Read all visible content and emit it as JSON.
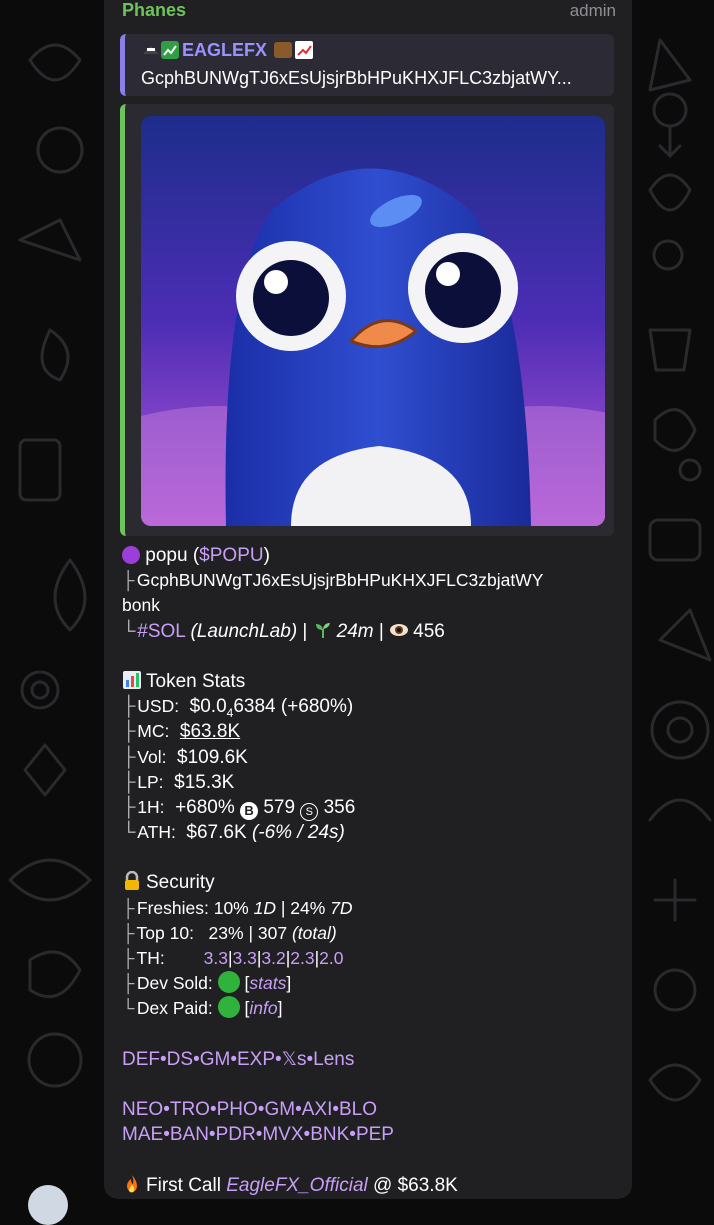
{
  "message": {
    "sender": "Phanes",
    "role": "admin"
  },
  "reply": {
    "title": "EAGLEFX",
    "text": "GcphBUNWgTJ6xEsUjsjrBbHPuKHXJFLC3zbjatWY..."
  },
  "token": {
    "name": "popu",
    "ticker": "($POPU)",
    "address_line1": "GcphBUNWgTJ6xEsUjsjrBbHPuKHXJFLC3zbjatWY",
    "address_line2": "bonk",
    "chain": "#SOL",
    "platform": "(LaunchLab)",
    "age": "24m",
    "views": "456"
  },
  "stats": {
    "heading": "Token Stats",
    "usd_label": "USD:",
    "usd_prefix": "$0.0",
    "usd_sub": "4",
    "usd_suffix": "6384 (+680%)",
    "mc_label": "MC:",
    "mc_value": "$63.8K",
    "vol_label": "Vol:",
    "vol_value": "$109.6K",
    "lp_label": "LP:",
    "lp_value": "$15.3K",
    "h1_label": "1H:",
    "h1_value": "+680%",
    "buys_icon": "B",
    "buys": "579",
    "sells_icon": "S",
    "sells": "356",
    "ath_label": "ATH:",
    "ath_value": "$67.6K",
    "ath_note": "(-6% / 24s)"
  },
  "security": {
    "heading": "Security",
    "freshies_label": "Freshies:",
    "freshies_a": "10%",
    "freshies_a_period": "1D",
    "freshies_b": "24%",
    "freshies_b_period": "7D",
    "top10_label": "Top 10:",
    "top10_pct": "23%",
    "top10_count": "307",
    "top10_note": "(total)",
    "th_label": "TH:",
    "th_values": [
      "3.3",
      "3.3",
      "3.2",
      "2.3",
      "2.0"
    ],
    "devsold_label": "Dev Sold:",
    "devsold_link": "stats",
    "dexpaid_label": "Dex Paid:",
    "dexpaid_link": "info"
  },
  "links_row1": [
    "DEF",
    "DS",
    "GM",
    "EXP",
    "𝕏s",
    "Lens"
  ],
  "links_row2": [
    "NEO",
    "TRO",
    "PHO",
    "GM",
    "AXI",
    "BLO"
  ],
  "links_row3": [
    "MAE",
    "BAN",
    "PDR",
    "MVX",
    "BNK",
    "PEP"
  ],
  "first_call": {
    "label": "First Call",
    "caller": "EagleFX_Official",
    "at": "@ $63.8K"
  },
  "colors": {
    "bubble": "#202023",
    "sender": "#6ec35c",
    "link": "#c89ff7",
    "reply_accent": "#8a7fe6"
  },
  "icons": [
    "chart-bar-icon",
    "lock-icon",
    "fire-icon",
    "seedling-icon",
    "eye-icon",
    "purple-circle-icon",
    "green-circle-icon"
  ]
}
